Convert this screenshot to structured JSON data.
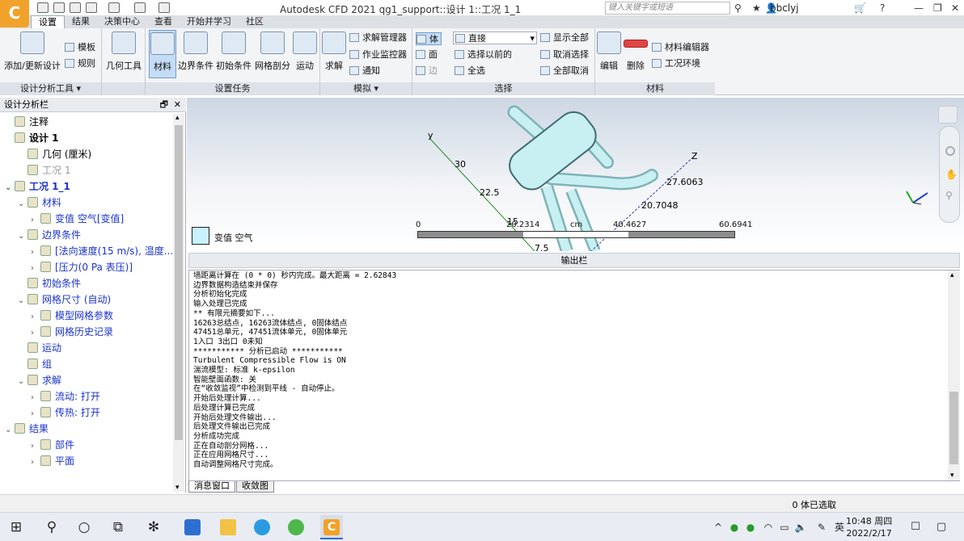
{
  "app": {
    "title": "Autodesk CFD 2021   qg1_support::设计 1::工况 1_1",
    "search_placeholder": "键入关键字或短语",
    "user": "bbclyj",
    "logo": "C"
  },
  "tabs": [
    "设置",
    "结果",
    "决策中心",
    "查看",
    "开始并学习",
    "社区"
  ],
  "ribbon": {
    "panel1": {
      "title": "设计分析工具 ▾",
      "add_update": "添加/更新设计",
      "template": "模板",
      "rules": "规则",
      "geometry_tools": "几何工具"
    },
    "panel2": {
      "title": "设置任务",
      "material": "材料",
      "boundary": "边界条件",
      "initial": "初始条件",
      "mesh": "网格剖分",
      "motion": "运动"
    },
    "panel3": {
      "title": "模拟 ▾",
      "solve": "求解",
      "solve_manager": "求解管理器",
      "job_monitor": "作业监控器",
      "notify": "通知"
    },
    "panel4": {
      "title": "选择",
      "body": "体",
      "face": "面",
      "edge": "边",
      "direct": "直接",
      "select_previous": "选择以前的",
      "select_all": "全选",
      "show_all": "显示全部",
      "cancel_select": "取消选择",
      "cancel_all": "全部取消"
    },
    "panel5": {
      "title": "材料",
      "edit": "编辑",
      "delete": "删除",
      "material_editor": "材料编辑器",
      "environment": "工况环境"
    }
  },
  "left_panel": {
    "title": "设计分析栏",
    "tree": [
      {
        "label": "注释",
        "indent": 0,
        "arrow": "",
        "style": ""
      },
      {
        "label": "设计 1",
        "indent": 0,
        "arrow": "",
        "style": "bold"
      },
      {
        "label": "几何 (厘米)",
        "indent": 1,
        "arrow": "",
        "style": ""
      },
      {
        "label": "工况 1",
        "indent": 1,
        "arrow": "",
        "style": "gray"
      },
      {
        "label": "工况 1_1",
        "indent": 0,
        "arrow": "⌄",
        "style": "bold blue"
      },
      {
        "label": "材料",
        "indent": 1,
        "arrow": "⌄",
        "style": "blue"
      },
      {
        "label": "变值 空气[变值]",
        "indent": 2,
        "arrow": "›",
        "style": "blue"
      },
      {
        "label": "边界条件",
        "indent": 1,
        "arrow": "⌄",
        "style": "blue"
      },
      {
        "label": "[法向速度(15 m/s), 温度...",
        "indent": 2,
        "arrow": "›",
        "style": "blue"
      },
      {
        "label": "[压力(0 Pa 表压)]",
        "indent": 2,
        "arrow": "›",
        "style": "blue"
      },
      {
        "label": "初始条件",
        "indent": 1,
        "arrow": "",
        "style": "blue"
      },
      {
        "label": "网格尺寸 (自动)",
        "indent": 1,
        "arrow": "⌄",
        "style": "blue"
      },
      {
        "label": "模型网格参数",
        "indent": 2,
        "arrow": "›",
        "style": "blue"
      },
      {
        "label": "网格历史记录",
        "indent": 2,
        "arrow": "›",
        "style": "blue"
      },
      {
        "label": "运动",
        "indent": 1,
        "arrow": "",
        "style": "blue"
      },
      {
        "label": "组",
        "indent": 1,
        "arrow": "",
        "style": "blue"
      },
      {
        "label": "求解",
        "indent": 1,
        "arrow": "⌄",
        "style": "blue"
      },
      {
        "label": "流动: 打开",
        "indent": 2,
        "arrow": "›",
        "style": "blue"
      },
      {
        "label": "传热: 打开",
        "indent": 2,
        "arrow": "›",
        "style": "blue"
      },
      {
        "label": "结果",
        "indent": 0,
        "arrow": "⌄",
        "style": "blue"
      },
      {
        "label": "部件",
        "indent": 2,
        "arrow": "›",
        "style": "blue"
      },
      {
        "label": "平面",
        "indent": 2,
        "arrow": "›",
        "style": "blue"
      }
    ]
  },
  "viewport": {
    "legend_label": "变值 空气",
    "scale_ticks": [
      "0",
      "20.2314",
      "cm",
      "40.4627",
      "60.6941"
    ],
    "axis_labels": {
      "y": "y",
      "z": "Z",
      "v30": "30",
      "v225": "22.5",
      "v15": "15",
      "v75": "7.5",
      "v276": "27.6063",
      "v207": "20.7048"
    }
  },
  "output": {
    "title": "输出栏",
    "lines": [
      "墙距离计算在 (0 * 0) 秒内完成。最大距离 = 2.62843",
      "边界数据构造结束并保存",
      "分析初始化完成",
      "输入处理已完成",
      "** 有限元摘要如下...",
      "16263总结点, 16263流体结点, 0固体结点",
      "47451总单元, 47451流体单元, 0固体单元",
      "1入口 3出口 0未知",
      "*********** 分析已启动 ***********",
      "Turbulent Compressible Flow is ON",
      "湍流模型: 标准 k-epsilon",
      "智能壁面函数: 关",
      "在“收敛监视”中检测到平线 - 自动停止。",
      "开始后处理计算...",
      "后处理计算已完成",
      "开始后处理文件输出...",
      "后处理文件输出已完成",
      "分析成功完成",
      "正在自动剖分网格...",
      "正在应用网格尺寸...",
      "自动调整网格尺寸完成。"
    ],
    "tabs": [
      "消息窗口",
      "收敛图"
    ]
  },
  "status": {
    "text": "0 体已选取"
  },
  "taskbar": {
    "time": "10:48 周四",
    "date": "2022/2/17",
    "ime": "英"
  }
}
